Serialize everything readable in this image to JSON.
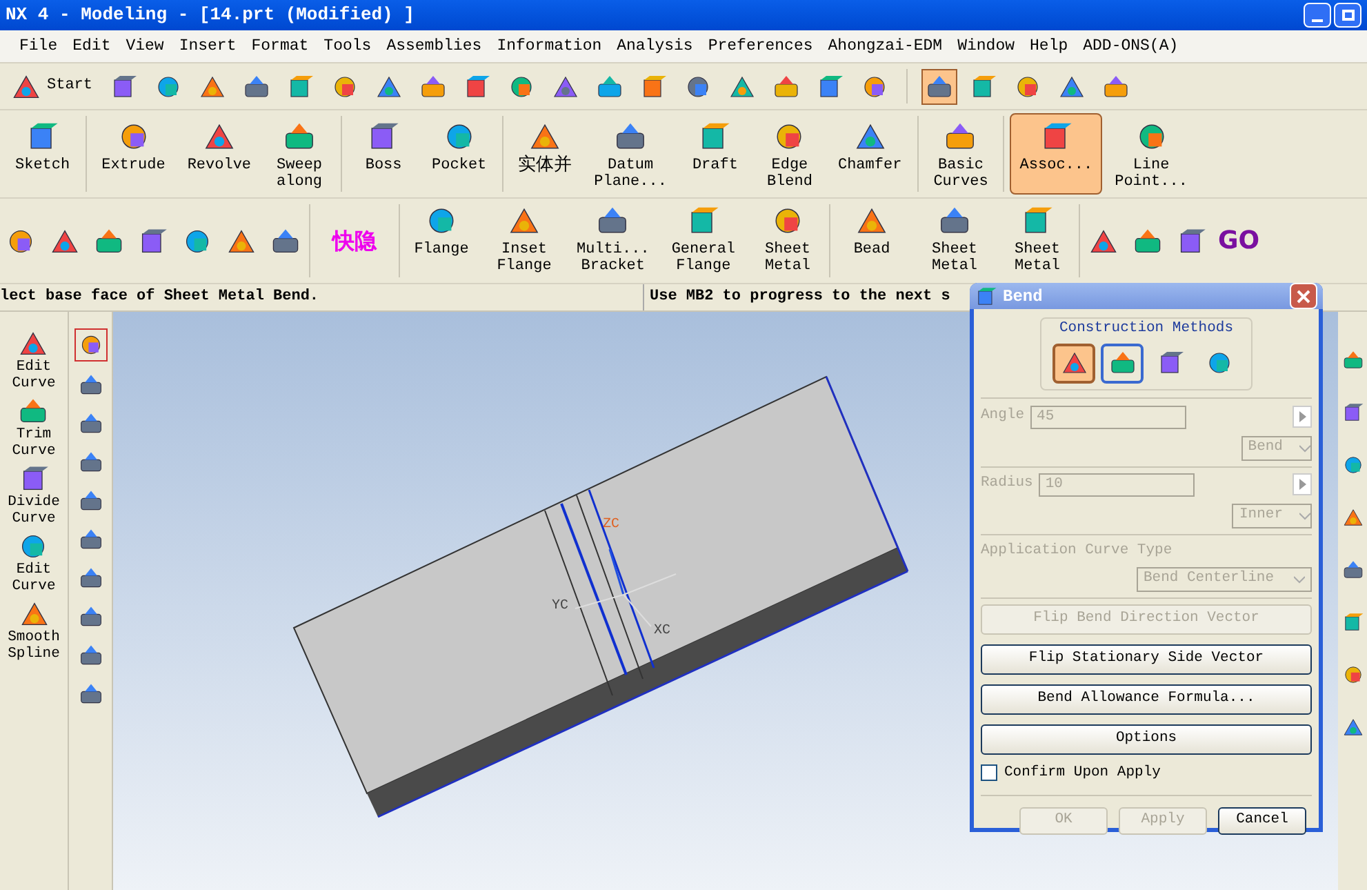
{
  "window": {
    "title": "NX 4 - Modeling - [14.prt (Modified) ]"
  },
  "menu": [
    "File",
    "Edit",
    "View",
    "Insert",
    "Format",
    "Tools",
    "Assemblies",
    "Information",
    "Analysis",
    "Preferences",
    "Ahongzai-EDM",
    "Window",
    "Help",
    "ADD-ONS(A)"
  ],
  "toolbar_1": {
    "start": "Start",
    "snap_tools": [
      {
        "selected": true
      },
      {
        "selected": false
      },
      {
        "selected": false
      },
      {
        "selected": false
      },
      {
        "selected": false
      }
    ]
  },
  "toolbar_2": [
    [
      {
        "lines": [
          "Sketch"
        ],
        "selected": false
      }
    ],
    [
      {
        "lines": [
          "Extrude"
        ],
        "selected": false
      },
      {
        "lines": [
          "Revolve"
        ],
        "selected": false
      },
      {
        "lines": [
          "Sweep",
          "along"
        ],
        "selected": false
      }
    ],
    [
      {
        "lines": [
          "Boss"
        ],
        "selected": false
      },
      {
        "lines": [
          "Pocket"
        ],
        "selected": false
      }
    ],
    [
      {
        "lines": [
          "实体并"
        ],
        "selected": false
      },
      {
        "lines": [
          "Datum",
          "Plane..."
        ],
        "selected": false
      },
      {
        "lines": [
          "Draft"
        ],
        "selected": false
      },
      {
        "lines": [
          "Edge",
          "Blend"
        ],
        "selected": false
      },
      {
        "lines": [
          "Chamfer"
        ],
        "selected": false
      }
    ],
    [
      {
        "lines": [
          "Basic",
          "Curves"
        ],
        "selected": false
      }
    ],
    [
      {
        "lines": [
          "Assoc..."
        ],
        "selected": true
      },
      {
        "lines": [
          "Line",
          "Point..."
        ],
        "selected": false
      }
    ]
  ],
  "toolbar_3": {
    "quick_hide": "快隐",
    "sheet_metal": [
      [
        {
          "lines": [
            "Flange"
          ]
        },
        {
          "lines": [
            "Inset",
            "Flange"
          ]
        },
        {
          "lines": [
            "Multi...",
            "Bracket"
          ]
        },
        {
          "lines": [
            "General",
            "Flange"
          ]
        },
        {
          "lines": [
            "Sheet",
            "Metal"
          ]
        }
      ],
      [
        {
          "lines": [
            "Bead"
          ]
        },
        {
          "lines": [
            "Sheet",
            "Metal"
          ]
        },
        {
          "lines": [
            "Sheet",
            "Metal"
          ]
        }
      ]
    ],
    "logo_text": "GO"
  },
  "status": {
    "prompt": "lect base face of Sheet Metal Bend.",
    "hint": "Use MB2 to progress to the next s"
  },
  "curve_tools": [
    {
      "lines": [
        "Edit",
        "Curve"
      ]
    },
    {
      "lines": [
        "Trim",
        "Curve"
      ]
    },
    {
      "lines": [
        "Divide",
        "Curve"
      ]
    },
    {
      "lines": [
        "Edit",
        "Curve"
      ]
    },
    {
      "lines": [
        "Smooth",
        "Spline"
      ]
    }
  ],
  "viewport": {
    "axis_label": "ZC",
    "axis_x": "YC",
    "axis_y": "XC"
  },
  "dialog": {
    "title": "Bend",
    "group_title": "Construction Methods",
    "methods": [
      {
        "selected": true,
        "focused": false
      },
      {
        "selected": false,
        "focused": true
      },
      {
        "selected": false,
        "focused": false
      },
      {
        "selected": false,
        "focused": false
      }
    ],
    "angle": {
      "label": "Angle",
      "value": "45",
      "disabled": true,
      "option": "Bend"
    },
    "radius": {
      "label": "Radius",
      "value": "10",
      "disabled": true,
      "option": "Inner"
    },
    "curve_type": {
      "label": "Application Curve Type",
      "value": "Bend Centerline",
      "disabled": true
    },
    "buttons": [
      {
        "label": "Flip Bend Direction Vector",
        "disabled": true
      },
      {
        "label": "Flip Stationary Side Vector",
        "disabled": false
      },
      {
        "label": "Bend Allowance Formula...",
        "disabled": false
      },
      {
        "label": "Options",
        "disabled": false
      }
    ],
    "confirm": {
      "label": "Confirm Upon Apply",
      "checked": false
    },
    "footer": [
      {
        "label": "OK",
        "disabled": true
      },
      {
        "label": "Apply",
        "disabled": true
      },
      {
        "label": "Cancel",
        "disabled": false
      }
    ]
  }
}
